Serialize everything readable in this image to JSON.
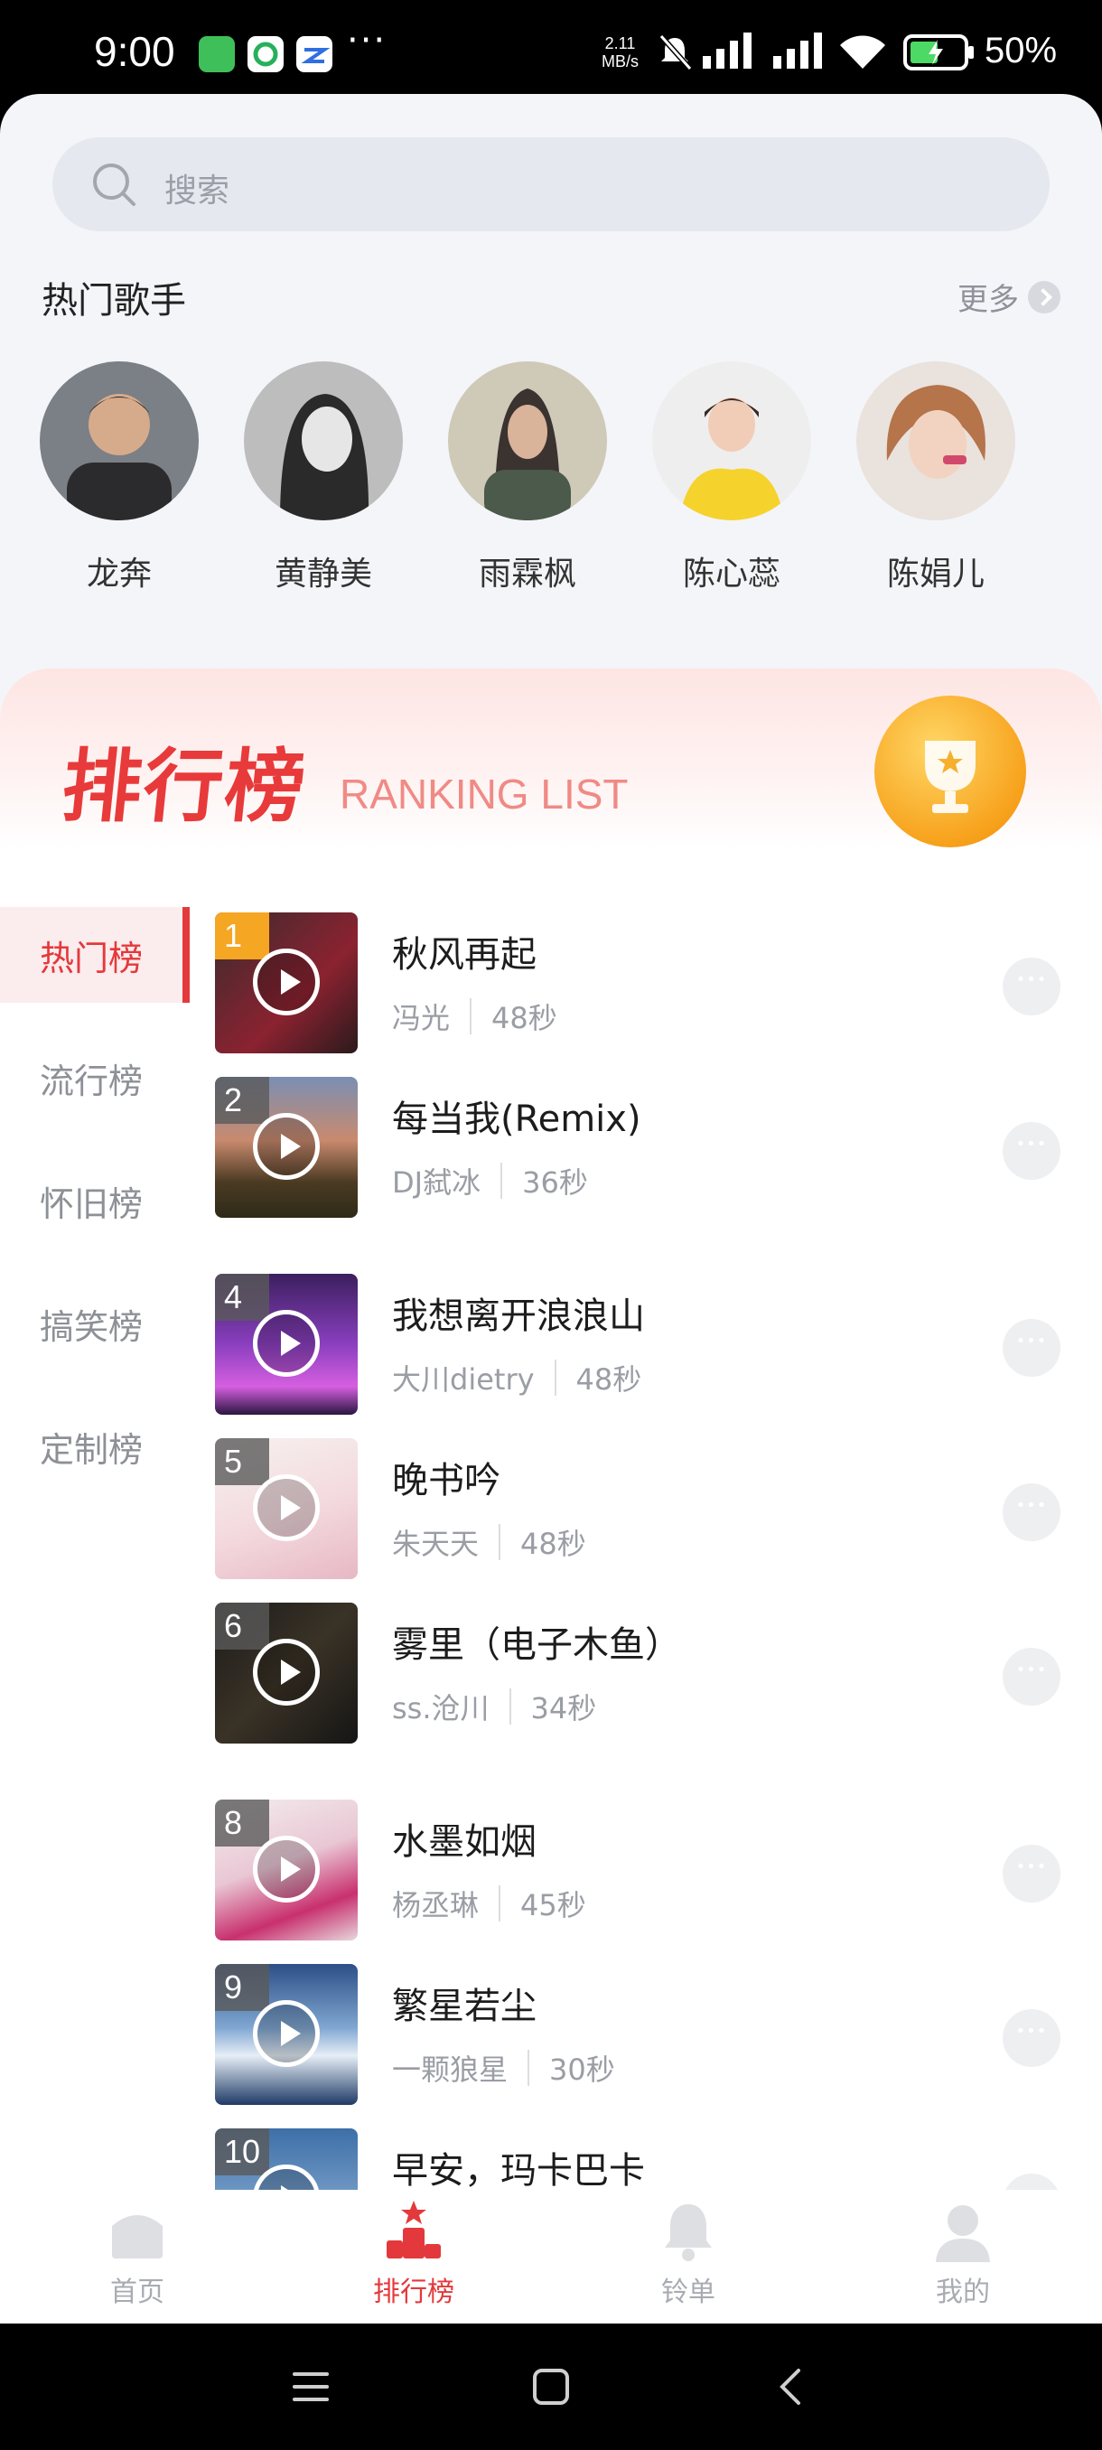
{
  "status_bar": {
    "time": "9:00",
    "dots": "···",
    "net_speed_top": "2.11",
    "net_speed_bottom": "MB/s",
    "battery_pct": "50%"
  },
  "search": {
    "placeholder": "搜索"
  },
  "hot_singers": {
    "title": "热门歌手",
    "more_label": "更多",
    "items": [
      {
        "name": "龙奔"
      },
      {
        "name": "黄静美"
      },
      {
        "name": "雨霖枫"
      },
      {
        "name": "陈心蕊"
      },
      {
        "name": "陈娟儿"
      }
    ]
  },
  "ranking": {
    "title": "排行榜",
    "subtitle": "RANKING LIST",
    "tabs": [
      {
        "label": "热门榜",
        "active": true
      },
      {
        "label": "流行榜",
        "active": false
      },
      {
        "label": "怀旧榜",
        "active": false
      },
      {
        "label": "搞笑榜",
        "active": false
      },
      {
        "label": "定制榜",
        "active": false
      }
    ],
    "songs": [
      {
        "rank": "1",
        "title": "秋风再起",
        "artist": "冯光",
        "duration": "48秒"
      },
      {
        "rank": "2",
        "title": "每当我(Remix)",
        "artist": "DJ弑冰",
        "duration": "36秒"
      },
      {
        "rank": "4",
        "title": "我想离开浪浪山",
        "artist": "大川dietry",
        "duration": "48秒"
      },
      {
        "rank": "5",
        "title": "晚书吟",
        "artist": "朱天天",
        "duration": "48秒"
      },
      {
        "rank": "6",
        "title": "雾里（电子木鱼）",
        "artist": "ss.沧川",
        "duration": "34秒"
      },
      {
        "rank": "8",
        "title": "水墨如烟",
        "artist": "杨丞琳",
        "duration": "45秒"
      },
      {
        "rank": "9",
        "title": "繁星若尘",
        "artist": "一颗狼星",
        "duration": "30秒"
      },
      {
        "rank": "10",
        "title": "早安，玛卡巴卡",
        "artist": "",
        "duration": ""
      }
    ]
  },
  "bottom_nav": [
    {
      "label": "首页",
      "icon": "home-icon",
      "active": false
    },
    {
      "label": "排行榜",
      "icon": "ranking-icon",
      "active": true
    },
    {
      "label": "铃单",
      "icon": "bell-icon",
      "active": false
    },
    {
      "label": "我的",
      "icon": "user-icon",
      "active": false
    }
  ],
  "colors": {
    "accent": "#e4393c",
    "rank_top": "#f5a623"
  }
}
